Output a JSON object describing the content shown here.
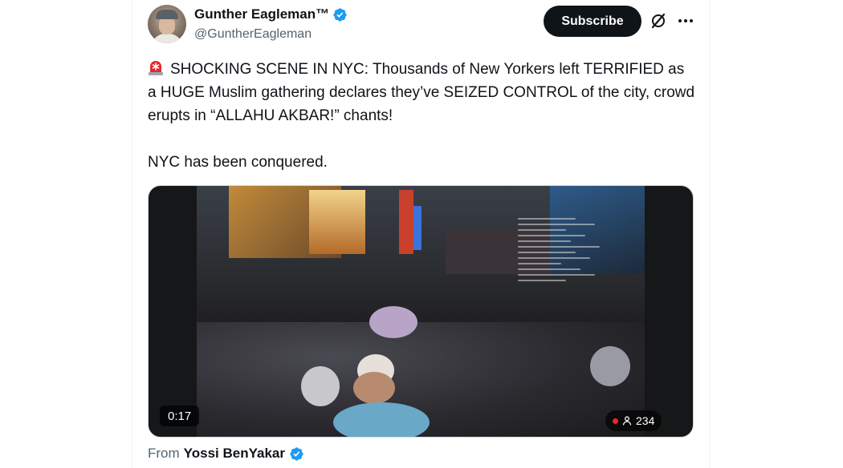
{
  "author": {
    "name": "Gunther Eagleman™",
    "handle": "@GuntherEagleman",
    "verified": true,
    "verified_color": "#1d9bf0"
  },
  "header_actions": {
    "subscribe_label": "Subscribe",
    "grok_icon": "grok-slash-icon",
    "more_icon": "ellipsis-icon"
  },
  "post": {
    "lead_icon": "rotating-light-emoji",
    "paragraph1": "SHOCKING SCENE IN NYC: Thousands of New Yorkers left TERRIFIED as a HUGE Muslim gathering declares they’ve SEIZED CONTROL of the city, crowd erupts in “ALLAHU AKBAR!” chants!",
    "paragraph2": "NYC has been conquered."
  },
  "video": {
    "timestamp": "0:17",
    "live_indicator_color": "#f4212e",
    "viewer_count": "234"
  },
  "attribution": {
    "prefix": "From",
    "name": "Yossi BenYakar",
    "verified": true
  }
}
